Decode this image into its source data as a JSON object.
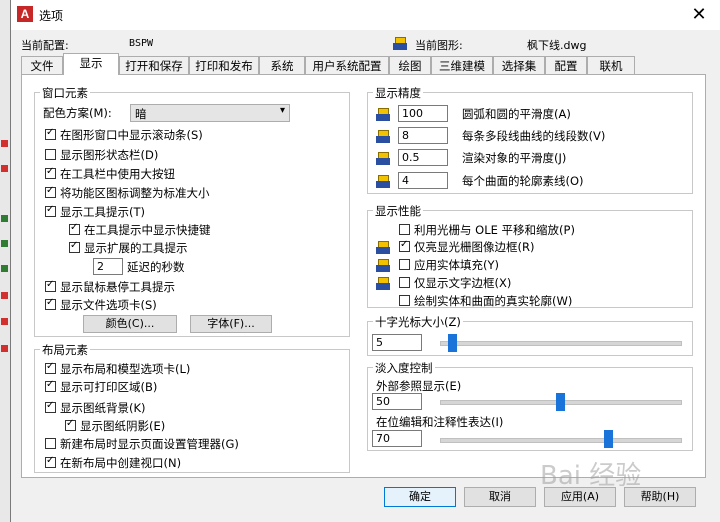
{
  "window": {
    "title": "选项",
    "close_glyph": "✕"
  },
  "profile": {
    "label": "当前配置:",
    "value": "BSPW"
  },
  "drawing": {
    "label": "当前图形:",
    "value": "枫下线.dwg"
  },
  "tabs": [
    {
      "label": "文件"
    },
    {
      "label": "显示",
      "active": true
    },
    {
      "label": "打开和保存"
    },
    {
      "label": "打印和发布"
    },
    {
      "label": "系统"
    },
    {
      "label": "用户系统配置"
    },
    {
      "label": "绘图"
    },
    {
      "label": "三维建模"
    },
    {
      "label": "选择集"
    },
    {
      "label": "配置"
    },
    {
      "label": "联机"
    }
  ],
  "window_elements": {
    "title": "窗口元素",
    "color_scheme_label": "配色方案(M):",
    "color_scheme_value": "暗",
    "options": [
      {
        "label": "在图形窗口中显示滚动条(S)",
        "checked": true
      },
      {
        "label": "显示图形状态栏(D)",
        "checked": false
      },
      {
        "label": "在工具栏中使用大按钮",
        "checked": true
      },
      {
        "label": "将功能区图标调整为标准大小",
        "checked": true
      },
      {
        "label": "显示工具提示(T)",
        "checked": true
      },
      {
        "label": "在工具提示中显示快捷键",
        "checked": true
      },
      {
        "label": "显示扩展的工具提示",
        "checked": true
      },
      {
        "label": "显示鼠标悬停工具提示",
        "checked": true
      },
      {
        "label": "显示文件选项卡(S)",
        "checked": true
      }
    ],
    "delay_value": "2",
    "delay_label": "延迟的秒数",
    "colors_button": "颜色(C)...",
    "fonts_button": "字体(F)..."
  },
  "layout_elements": {
    "title": "布局元素",
    "options": [
      {
        "label": "显示布局和模型选项卡(L)",
        "checked": true
      },
      {
        "label": "显示可打印区域(B)",
        "checked": true
      },
      {
        "label": "显示图纸背景(K)",
        "checked": true
      },
      {
        "label": "显示图纸阴影(E)",
        "checked": true
      },
      {
        "label": "新建布局时显示页面设置管理器(G)",
        "checked": false
      },
      {
        "label": "在新布局中创建视口(N)",
        "checked": true
      }
    ]
  },
  "display_resolution": {
    "title": "显示精度",
    "items": [
      {
        "value": "100",
        "label": "圆弧和圆的平滑度(A)"
      },
      {
        "value": "8",
        "label": "每条多段线曲线的线段数(V)"
      },
      {
        "value": "0.5",
        "label": "渲染对象的平滑度(J)"
      },
      {
        "value": "4",
        "label": "每个曲面的轮廓素线(O)"
      }
    ]
  },
  "display_performance": {
    "title": "显示性能",
    "options": [
      {
        "label": "利用光栅与 OLE 平移和缩放(P)",
        "checked": false
      },
      {
        "label": "仅亮显光栅图像边框(R)",
        "checked": true
      },
      {
        "label": "应用实体填充(Y)",
        "checked": false
      },
      {
        "label": "仅显示文字边框(X)",
        "checked": false
      },
      {
        "label": "绘制实体和曲面的真实轮廓(W)",
        "checked": false
      }
    ]
  },
  "crosshair": {
    "title": "十字光标大小(Z)",
    "value": "5",
    "level_percent": 5
  },
  "fade": {
    "title": "淡入度控制",
    "xref_label": "外部参照显示(E)",
    "xref_value": "50",
    "xref_level_percent": 50,
    "inplace_label": "在位编辑和注释性表达(I)",
    "inplace_value": "70",
    "inplace_level_percent": 70
  },
  "buttons": {
    "ok": "确定",
    "cancel": "取消",
    "apply": "应用(A)",
    "help": "帮助(H)"
  },
  "watermark": "Bai 经验"
}
